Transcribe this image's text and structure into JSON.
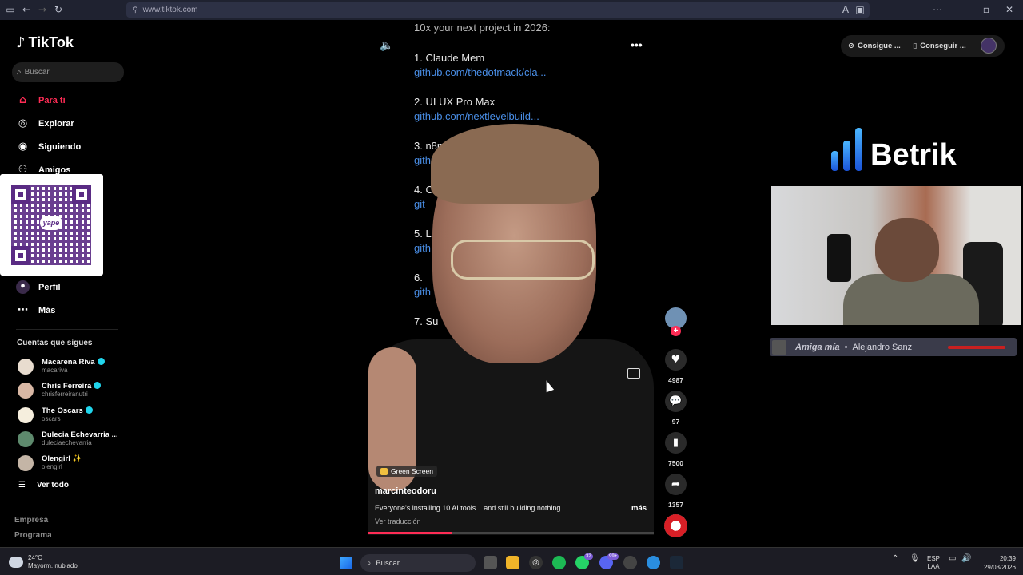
{
  "browser": {
    "url": "www.tiktok.com"
  },
  "sidebar": {
    "logo": "TikTok",
    "search_placeholder": "Buscar",
    "nav": [
      {
        "label": "Para ti",
        "icon": "home-icon",
        "active": true
      },
      {
        "label": "Explorar",
        "icon": "compass-icon"
      },
      {
        "label": "Siguiendo",
        "icon": "following-icon"
      },
      {
        "label": "Amigos",
        "icon": "friends-icon"
      },
      {
        "label": "Perfil",
        "icon": "profile-icon"
      },
      {
        "label": "Más",
        "icon": "more-icon"
      }
    ],
    "following_title": "Cuentas que sigues",
    "following": [
      {
        "name": "Macarena Riva",
        "username": "macariva",
        "verified": true
      },
      {
        "name": "Chris Ferreira",
        "username": "chrisferreiranutri",
        "verified": true
      },
      {
        "name": "The Oscars",
        "username": "oscars",
        "verified": true
      },
      {
        "name": "Dulecia Echevarria ...",
        "username": "duleciaechevarria",
        "verified": false
      },
      {
        "name": "Olengirl ✨",
        "username": "olengirl",
        "verified": false
      }
    ],
    "see_all": "Ver todo",
    "footer": [
      "Empresa",
      "Programa"
    ]
  },
  "qr": {
    "brand": "yape"
  },
  "video": {
    "text_lines": [
      {
        "text": "10x your next project in 2026:",
        "kind": "text"
      },
      {
        "text": "1. Claude Mem",
        "kind": "text"
      },
      {
        "text": "github.com/thedotmack/cla...",
        "kind": "link"
      },
      {
        "text": "2. UI UX Pro Max",
        "kind": "text"
      },
      {
        "text": "github.com/nextlevelbuild...",
        "kind": "link"
      },
      {
        "text": "3. n8n-MC",
        "kind": "text"
      },
      {
        "text": "githu",
        "kind": "link"
      },
      {
        "text": "4. C",
        "kind": "text"
      },
      {
        "text": "git",
        "kind": "link"
      },
      {
        "text": "5. L",
        "kind": "text"
      },
      {
        "text": "gith",
        "kind": "link"
      },
      {
        "text": "6.",
        "kind": "text"
      },
      {
        "text": "gith",
        "kind": "link"
      },
      {
        "text": "7. Su",
        "kind": "text"
      }
    ],
    "tag": "Green Screen",
    "author": "marcinteodoru",
    "caption": "Everyone's installing 10 AI tools... and still building nothing...",
    "more": "más",
    "translate": "Ver traducción",
    "progress": 0.29
  },
  "actions": {
    "likes": "4987",
    "comments": "97",
    "saves": "7500",
    "shares": "1357"
  },
  "topbar": {
    "btn1": "Consigue ...",
    "btn2": "Conseguir ..."
  },
  "stream": {
    "brand": "Betrik",
    "song": "Amiga mía",
    "separator": "•",
    "artist": "Alejandro Sanz"
  },
  "taskbar": {
    "temp": "24°C",
    "weather": "Mayorm. nublado",
    "search": "Buscar",
    "lang1": "ESP",
    "lang2": "LAA",
    "time": "20:39",
    "date": "29/03/2026",
    "badge_whatsapp": "32",
    "badge_discord": "99+"
  },
  "colors": {
    "accent": "#fe2c55",
    "link": "#4a8fe8",
    "verified": "#20d5ec"
  }
}
